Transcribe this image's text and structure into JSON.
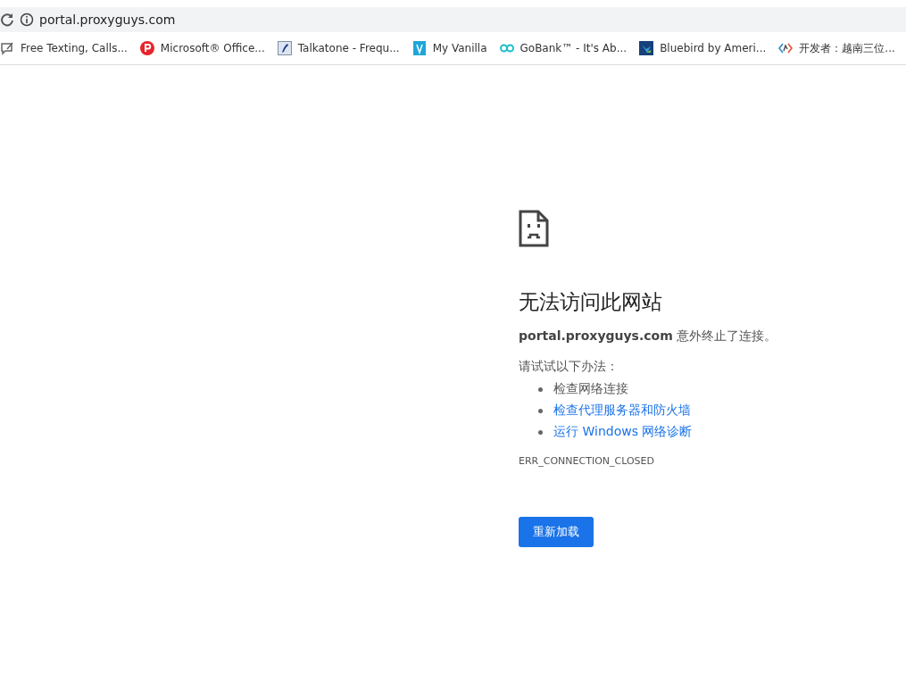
{
  "address_bar": {
    "url": "portal.proxyguys.com"
  },
  "bookmarks": [
    {
      "label": "Free Texting, Calls...",
      "kind": "chat"
    },
    {
      "label": "Microsoft® Office...",
      "kind": "p"
    },
    {
      "label": "Talkatone - Frequ...",
      "kind": "phone"
    },
    {
      "label": "My Vanilla",
      "kind": "card"
    },
    {
      "label": "GoBank™ - It's Ab...",
      "kind": "go"
    },
    {
      "label": "Bluebird by Ameri...",
      "kind": "bird"
    },
    {
      "label": "开发者：越南三位...",
      "kind": "code"
    }
  ],
  "error": {
    "title": "无法访问此网站",
    "message": "**portal.proxyguys.com** 意外终止了连接。",
    "suggestions_heading": "请试试以下办法：",
    "suggestions": [
      {
        "text": "检查网络连接",
        "kind": "text"
      },
      {
        "text": "检查代理服务器和防火墙",
        "kind": "link"
      },
      {
        "text": "运行 Windows 网络诊断",
        "kind": "link"
      }
    ],
    "code": "ERR_CONNECTION_CLOSED",
    "button": "重新加载"
  }
}
